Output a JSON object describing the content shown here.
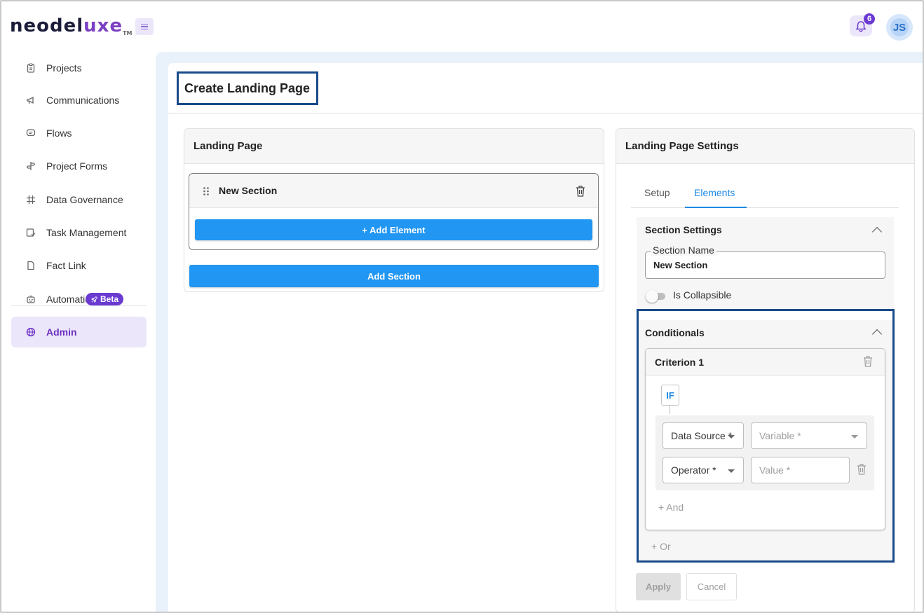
{
  "app": {
    "logo_main": "neodel",
    "logo_accent": "uxe",
    "logo_tm": "TM",
    "notifications_count": "6",
    "user_initials": "JS"
  },
  "sidebar": {
    "items": [
      {
        "label": "Projects",
        "icon": "clipboard-icon"
      },
      {
        "label": "Communications",
        "icon": "megaphone-icon"
      },
      {
        "label": "Flows",
        "icon": "chat-icon"
      },
      {
        "label": "Project Forms",
        "icon": "signpost-icon"
      },
      {
        "label": "Data Governance",
        "icon": "hash-icon"
      },
      {
        "label": "Task Management",
        "icon": "task-icon"
      },
      {
        "label": "Fact Link",
        "icon": "document-icon"
      },
      {
        "label": "Automation",
        "icon": "robot-icon",
        "badge": "Beta"
      },
      {
        "label": "Admin",
        "icon": "globe-icon",
        "active": true
      }
    ]
  },
  "page": {
    "title": "Create Landing Page"
  },
  "landing_page": {
    "title": "Landing Page",
    "section_name": "New Section",
    "add_element_label": "+ Add Element",
    "add_section_label": "Add Section"
  },
  "settings": {
    "title": "Landing Page Settings",
    "tabs": [
      "Setup",
      "Elements"
    ],
    "active_tab": "Elements",
    "section_settings": {
      "title": "Section Settings",
      "name_label": "Section Name",
      "name_value": "New Section",
      "collapsible_label": "Is Collapsible",
      "collapsible": false
    },
    "conditionals": {
      "title": "Conditionals",
      "criterion_title": "Criterion 1",
      "if_label": "IF",
      "data_source_placeholder": "Data Source *",
      "variable_placeholder": "Variable *",
      "operator_placeholder": "Operator *",
      "value_placeholder": "Value *",
      "and_label": "+ And",
      "or_label": "+ Or"
    },
    "apply_label": "Apply",
    "cancel_label": "Cancel"
  },
  "colors": {
    "accent": "#2196f3",
    "brand": "#6a3ad1",
    "highlight_outline": "#1a4a8a"
  }
}
